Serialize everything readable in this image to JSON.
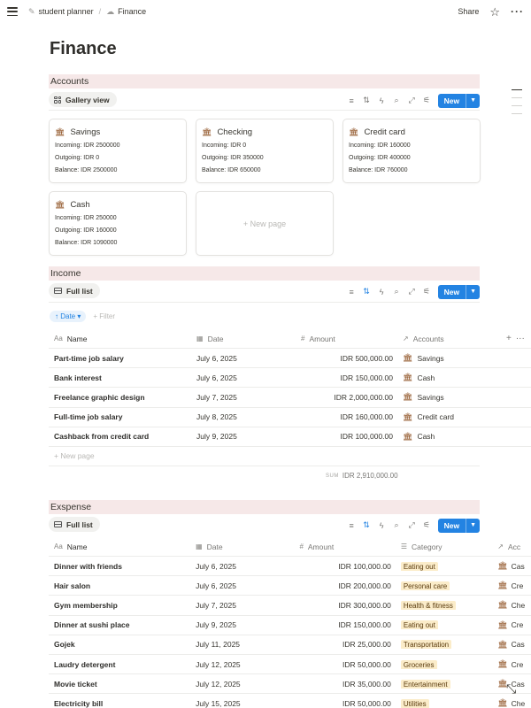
{
  "breadcrumb": {
    "parent": "student planner",
    "current": "Finance"
  },
  "top_actions": {
    "share": "Share"
  },
  "page_title": "Finance",
  "accounts": {
    "heading": "Accounts",
    "view": "Gallery view",
    "new_label": "New",
    "new_page_label": "+ New page",
    "cards": [
      {
        "title": "Savings",
        "incoming": "Incoming: IDR 2500000",
        "outgoing": "Outgoing: IDR 0",
        "balance": "Balance: IDR 2500000"
      },
      {
        "title": "Checking",
        "incoming": "Incoming: IDR 0",
        "outgoing": "Outgoing: IDR 350000",
        "balance": "Balance: IDR 650000"
      },
      {
        "title": "Credit card",
        "incoming": "Incoming: IDR 160000",
        "outgoing": "Outgoing: IDR 400000",
        "balance": "Balance: IDR 760000"
      },
      {
        "title": "Cash",
        "incoming": "Incoming: IDR 250000",
        "outgoing": "Outgoing: IDR 160000",
        "balance": "Balance: IDR 1090000"
      }
    ]
  },
  "income": {
    "heading": "Income",
    "view": "Full list",
    "new_label": "New",
    "sort_chip": "↑ Date ▾",
    "filter_label": "+ Filter",
    "columns": {
      "name": "Name",
      "date": "Date",
      "amount": "Amount",
      "accounts": "Accounts"
    },
    "rows": [
      {
        "name": "Part-time job salary",
        "date": "July 6, 2025",
        "amount": "IDR 500,000.00",
        "account": "Savings"
      },
      {
        "name": "Bank interest",
        "date": "July 6, 2025",
        "amount": "IDR 150,000.00",
        "account": "Cash"
      },
      {
        "name": "Freelance graphic design",
        "date": "July 7, 2025",
        "amount": "IDR 2,000,000.00",
        "account": "Savings"
      },
      {
        "name": "Full-time job salary",
        "date": "July 8, 2025",
        "amount": "IDR 160,000.00",
        "account": "Credit card"
      },
      {
        "name": "Cashback from credit card",
        "date": "July 9, 2025",
        "amount": "IDR 100,000.00",
        "account": "Cash"
      }
    ],
    "new_page_label": "+ New page",
    "sum_label": "SUM",
    "sum_value": "IDR 2,910,000.00"
  },
  "expense": {
    "heading": "Exspense",
    "view": "Full list",
    "new_label": "New",
    "columns": {
      "name": "Name",
      "date": "Date",
      "amount": "Amount",
      "category": "Category",
      "accounts": "Acc"
    },
    "rows": [
      {
        "name": "Dinner with friends",
        "date": "July 6, 2025",
        "amount": "IDR 100,000.00",
        "category": "Eating out",
        "account": "Cas"
      },
      {
        "name": "Hair salon",
        "date": "July 6, 2025",
        "amount": "IDR 200,000.00",
        "category": "Personal care",
        "account": "Cre"
      },
      {
        "name": "Gym membership",
        "date": "July 7, 2025",
        "amount": "IDR 300,000.00",
        "category": "Health & fitness",
        "account": "Che"
      },
      {
        "name": "Dinner at sushi place",
        "date": "July 9, 2025",
        "amount": "IDR 150,000.00",
        "category": "Eating out",
        "account": "Cre"
      },
      {
        "name": "Gojek",
        "date": "July 11, 2025",
        "amount": "IDR 25,000.00",
        "category": "Transportation",
        "account": "Cas"
      },
      {
        "name": "Laudry detergent",
        "date": "July 12, 2025",
        "amount": "IDR 50,000.00",
        "category": "Groceries",
        "account": "Cre"
      },
      {
        "name": "Movie ticket",
        "date": "July 12, 2025",
        "amount": "IDR 35,000.00",
        "category": "Entertainment",
        "account": "Cas"
      },
      {
        "name": "Electricity bill",
        "date": "July 15, 2025",
        "amount": "IDR 50,000.00",
        "category": "Utilities",
        "account": "Che"
      }
    ]
  },
  "colors": {
    "accent": "#2383e2",
    "section_bg": "#f6e8e8",
    "tag_bg": "#fbecc9"
  }
}
